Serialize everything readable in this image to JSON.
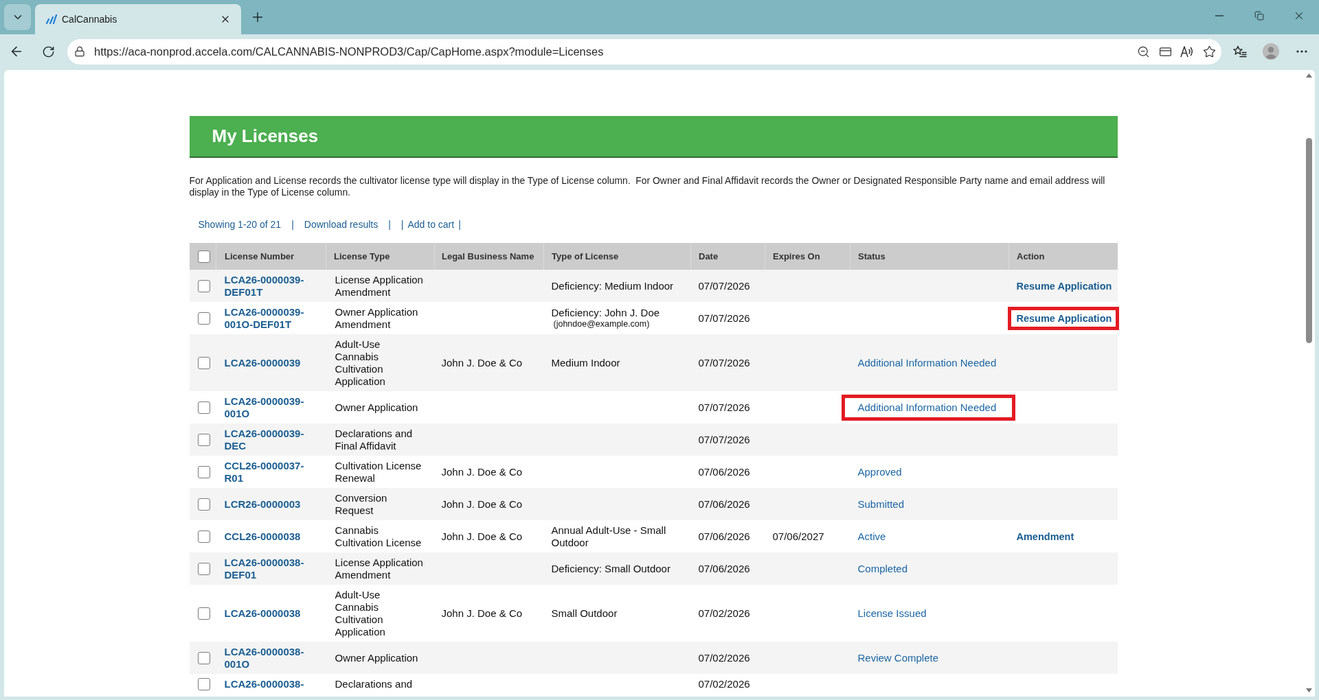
{
  "browser": {
    "tabs": [
      {
        "title": "CalCannabis",
        "selected": true
      }
    ],
    "address": "https://aca-nonprod.accela.com/CALCANNABIS-NONPROD3/Cap/CapHome.aspx?module=Licenses"
  },
  "page": {
    "title": "My Licenses",
    "intro": "For Application and License records the cultivator license type will display in the Type of License column.  For Owner and Final Affidavit records the Owner or Designated Responsible Party name and email address will display in the Type of License column.",
    "result_bar": [
      {
        "kind": "count",
        "text": "Showing 1-20 of 21"
      },
      {
        "kind": "separator",
        "text": "|"
      },
      {
        "kind": "link",
        "text": "Download results"
      },
      {
        "kind": "separator",
        "text": "|"
      },
      {
        "kind": "separator",
        "text": "|"
      },
      {
        "kind": "link",
        "text": "Add to cart"
      },
      {
        "kind": "separator",
        "text": "|"
      }
    ],
    "table": {
      "select_all": {
        "checked": false
      },
      "columns": [
        "License Number",
        "License Type",
        "Legal Business Name",
        "Type of License",
        "Date",
        "Expires On",
        "Status",
        "Action"
      ],
      "rows": [
        {
          "checked": false,
          "license_number": "LCA26-0000039-DEF01T",
          "license_type": "License Application Amendment",
          "type_of_license": "Deficiency: Medium Indoor",
          "date": "07/07/2026",
          "action": {
            "text": "Resume Application",
            "highlighted": false
          }
        },
        {
          "checked": false,
          "license_number": "LCA26-0000039-001O-DEF01T",
          "license_type": "Owner Application Amendment",
          "type_of_license": "Deficiency: John J. Doe",
          "type_of_license_email": "(johndoe@example.com)",
          "date": "07/07/2026",
          "action": {
            "text": "Resume Application",
            "highlighted": true
          }
        },
        {
          "checked": false,
          "license_number": "LCA26-0000039",
          "license_type": "Adult-Use Cannabis Cultivation Application",
          "legal_business_name": "John J. Doe & Co",
          "type_of_license": "Medium Indoor",
          "date": "07/07/2026",
          "status": {
            "text": "Additional Information Needed",
            "highlighted": false
          }
        },
        {
          "checked": false,
          "license_number": "LCA26-0000039-001O",
          "license_type": "Owner Application",
          "date": "07/07/2026",
          "status": {
            "text": "Additional Information Needed",
            "highlighted": true
          }
        },
        {
          "checked": false,
          "license_number": "LCA26-0000039-DEC",
          "license_type": "Declarations and Final Affidavit",
          "date": "07/07/2026"
        },
        {
          "checked": false,
          "license_number": "CCL26-0000037-R01",
          "license_type": "Cultivation License Renewal",
          "legal_business_name": "John J. Doe & Co",
          "date": "07/06/2026",
          "status": {
            "text": "Approved",
            "highlighted": false
          }
        },
        {
          "checked": false,
          "license_number": "LCR26-0000003",
          "license_type": "Conversion Request",
          "legal_business_name": "John J. Doe & Co",
          "date": "07/06/2026",
          "status": {
            "text": "Submitted",
            "highlighted": false
          }
        },
        {
          "checked": false,
          "license_number": "CCL26-0000038",
          "license_type": "Cannabis Cultivation License",
          "legal_business_name": "John J. Doe & Co",
          "type_of_license": "Annual Adult-Use - Small Outdoor",
          "date": "07/06/2026",
          "expires_on": "07/06/2027",
          "status": {
            "text": "Active",
            "highlighted": false
          },
          "action": {
            "text": "Amendment",
            "highlighted": false
          }
        },
        {
          "checked": false,
          "license_number": "LCA26-0000038-DEF01",
          "license_type": "License Application Amendment",
          "type_of_license": "Deficiency: Small Outdoor",
          "date": "07/06/2026",
          "status": {
            "text": "Completed",
            "highlighted": false
          }
        },
        {
          "checked": false,
          "license_number": "LCA26-0000038",
          "license_type": "Adult-Use Cannabis Cultivation Application",
          "legal_business_name": "John J. Doe & Co",
          "type_of_license": "Small Outdoor",
          "date": "07/02/2026",
          "status": {
            "text": "License Issued",
            "highlighted": false
          }
        },
        {
          "checked": false,
          "license_number": "LCA26-0000038-001O",
          "license_type": "Owner Application",
          "date": "07/02/2026",
          "status": {
            "text": "Review Complete",
            "highlighted": false
          }
        },
        {
          "checked": false,
          "license_number": "LCA26-0000038-",
          "license_type": "Declarations and",
          "date": "07/02/2026"
        }
      ]
    }
  }
}
